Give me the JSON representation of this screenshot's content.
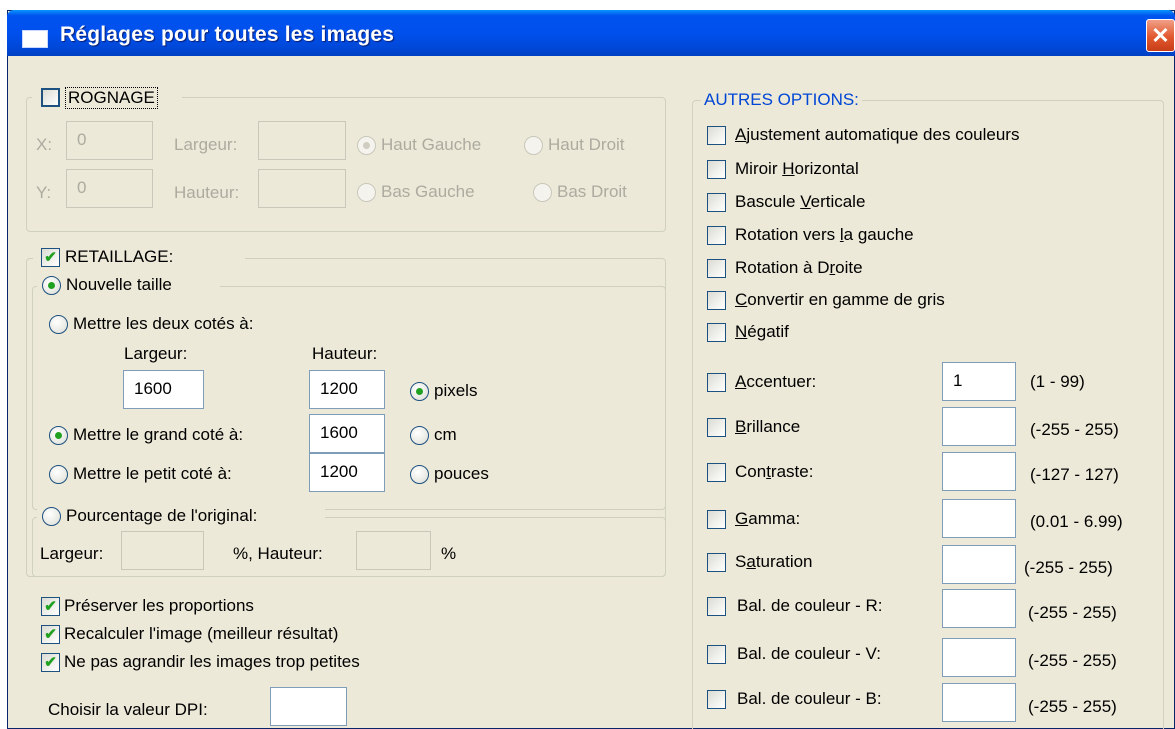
{
  "window": {
    "title": "Réglages pour toutes les images",
    "close_glyph": "✕"
  },
  "rognage": {
    "label": "ROGNAGE",
    "checked": false,
    "x_label": "X:",
    "x_value": "0",
    "y_label": "Y:",
    "y_value": "0",
    "largeur_label": "Largeur:",
    "hauteur_label": "Hauteur:",
    "haut_gauche": "Haut Gauche",
    "haut_droit": "Haut Droit",
    "bas_gauche": "Bas Gauche",
    "bas_droit": "Bas Droit"
  },
  "retaillage": {
    "label": "RETAILLAGE:",
    "checked": true,
    "nouvelle_taille": "Nouvelle taille",
    "deux_cotes": "Mettre les deux cotés à:",
    "largeur_label": "Largeur:",
    "hauteur_label": "Hauteur:",
    "largeur_value": "1600",
    "hauteur_value": "1200",
    "pixels": "pixels",
    "cm": "cm",
    "pouces": "pouces",
    "grand_cote": "Mettre le grand coté à:",
    "grand_cote_value": "1600",
    "petit_cote": "Mettre le petit coté à:",
    "petit_cote_value": "1200",
    "pourcentage": "Pourcentage de l'original:",
    "pct_largeur_label": "Largeur:",
    "pct_sep": "%,  Hauteur:",
    "pct_suffix": "%"
  },
  "options_bottom": {
    "preserver": "Préserver les proportions",
    "recalculer": "Recalculer l'image (meilleur résultat)",
    "ne_pas_agrandir": "Ne pas agrandir les images trop petites",
    "dpi_label": "Choisir la valeur DPI:",
    "dpi_value": ""
  },
  "autres": {
    "title": "AUTRES OPTIONS:",
    "ajust_pre": "",
    "ajust_u": "A",
    "ajust_post": "justement automatique des couleurs",
    "miroir_pre": "Miroir ",
    "miroir_u": "H",
    "miroir_post": "orizontal",
    "bascule_pre": "Bascule ",
    "bascule_u": "V",
    "bascule_post": "erticale",
    "rotg_pre": "Rotation vers ",
    "rotg_u": "l",
    "rotg_post": "a gauche",
    "rotd_pre": "Rotation à D",
    "rotd_u": "r",
    "rotd_post": "oite",
    "gris_pre": "",
    "gris_u": "C",
    "gris_post": "onvertir en gamme de gris",
    "neg_pre": "",
    "neg_u": "N",
    "neg_post": "égatif",
    "acc_pre": "",
    "acc_u": "A",
    "acc_post": "ccentuer:",
    "acc_value": "1",
    "acc_range": "(1 - 99)",
    "bri_pre": "",
    "bri_u": "B",
    "bri_post": "rillance",
    "bri_value": "",
    "bri_range": "(-255 - 255)",
    "con_pre": "Con",
    "con_u": "t",
    "con_post": "raste:",
    "con_value": "",
    "con_range": "(-127 - 127)",
    "gam_pre": "",
    "gam_u": "G",
    "gam_post": "amma:",
    "gam_value": "",
    "gam_range": "(0.01 - 6.99)",
    "sat_pre": "S",
    "sat_u": "a",
    "sat_post": "turation",
    "sat_value": "",
    "sat_range": "(-255  -  255)",
    "balr": "Bal. de couleur - R:",
    "balr_value": "",
    "balr_range": "(-255  -  255)",
    "balv": "Bal. de couleur - V:",
    "balv_value": "",
    "balv_range": "(-255  -  255)",
    "balb": "Bal. de couleur - B:",
    "balb_value": "",
    "balb_range": "(-255  -  255)"
  }
}
